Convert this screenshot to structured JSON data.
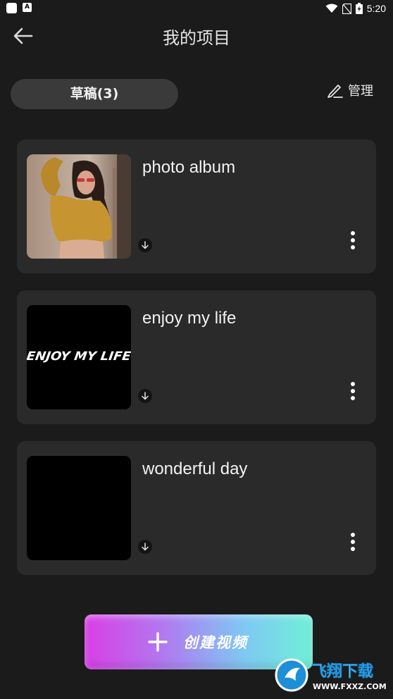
{
  "status_bar": {
    "time": "5:20",
    "notif_badge": "A"
  },
  "header": {
    "title": "我的项目"
  },
  "tabs": {
    "drafts": "草稿(3)"
  },
  "actions": {
    "manage": "管理"
  },
  "projects": [
    {
      "title": "photo album",
      "thumbnail": "portrait-photo"
    },
    {
      "title": "enjoy my life",
      "thumbnail": "text-graphic",
      "thumbnail_text": "ENJOY MY LIFE"
    },
    {
      "title": "wonderful day",
      "thumbnail": "black"
    }
  ],
  "create_button": {
    "label": "创建视频"
  },
  "watermark": {
    "text": "飞翔下载",
    "url": "WWW.FXXZ.COM"
  },
  "colors": {
    "background": "#1b1b1b",
    "card": "#2a2a2a",
    "pill": "#3a3a3a",
    "gradient_start": "#d93ee6",
    "gradient_end": "#6ff0d8"
  }
}
